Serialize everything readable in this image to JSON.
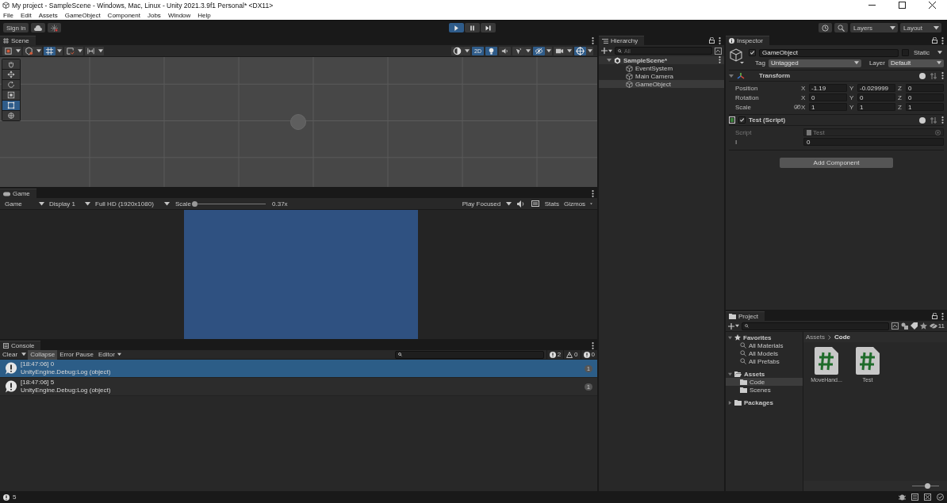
{
  "window": {
    "title": "My project - SampleScene - Windows, Mac, Linux - Unity 2021.3.9f1 Personal* <DX11>"
  },
  "menu": [
    "File",
    "Edit",
    "Assets",
    "GameObject",
    "Component",
    "Jobs",
    "Window",
    "Help"
  ],
  "toolbar": {
    "sign_in": "Sign in",
    "play_controls": [
      {
        "kind": "play",
        "on": true
      },
      {
        "kind": "pause",
        "on": false
      },
      {
        "kind": "step",
        "on": false
      }
    ],
    "layers": "Layers",
    "layout": "Layout"
  },
  "scene": {
    "tab": "Scene",
    "left_toggles": [
      {
        "kind": "draw-mode",
        "on": false
      },
      {
        "kind": "view-options",
        "on": false
      },
      {
        "kind": "grid",
        "on": true
      },
      {
        "kind": "snap",
        "on": false
      },
      {
        "kind": "align",
        "on": false
      }
    ],
    "right_toggles": [
      {
        "kind": "shading",
        "on": false
      },
      {
        "kind": "dimension",
        "label": "2D",
        "on": true
      },
      {
        "kind": "light",
        "on": true
      },
      {
        "kind": "audio",
        "on": false
      },
      {
        "kind": "effects",
        "on": false
      },
      {
        "kind": "visibility",
        "on": true
      },
      {
        "kind": "camera",
        "on": false
      },
      {
        "kind": "gizmos",
        "on": true
      }
    ],
    "tools": [
      {
        "kind": "hand",
        "selected": false
      },
      {
        "kind": "move",
        "selected": false
      },
      {
        "kind": "rotate",
        "selected": false
      },
      {
        "kind": "scale",
        "selected": false
      },
      {
        "kind": "rect",
        "selected": true
      },
      {
        "kind": "transform",
        "selected": false
      }
    ]
  },
  "game": {
    "tab": "Game",
    "view": "Game",
    "display": "Display 1",
    "resolution": "Full HD (1920x1080)",
    "scale_label": "Scale",
    "scale": {
      "level": 0.02
    },
    "scale_reading": "0.37x",
    "play_mode": "Play Focused",
    "stats": "Stats",
    "gizmos": "Gizmos"
  },
  "console": {
    "tab": "Console",
    "clear": "Clear",
    "toggles": [
      {
        "label": "Collapse",
        "on": true
      },
      {
        "label": "Error Pause",
        "on": false
      }
    ],
    "editor": "Editor",
    "counts": [
      {
        "kind": "info",
        "count": "2"
      },
      {
        "kind": "warning",
        "count": "0"
      },
      {
        "kind": "error",
        "count": "0"
      }
    ],
    "entries": [
      {
        "message": "[18:47:06] 0",
        "detail": "UnityEngine.Debug:Log (object)",
        "count": "1",
        "selected": true
      },
      {
        "message": "[18:47:06] 5",
        "detail": "UnityEngine.Debug:Log (object)",
        "count": "1",
        "selected": false
      }
    ]
  },
  "hierarchy": {
    "tab": "Hierarchy",
    "search_placeholder": "All",
    "tree": [
      {
        "label": "SampleScene*",
        "expanded": true,
        "selected": false,
        "children": [
          {
            "label": "EventSystem",
            "selected": false
          },
          {
            "label": "Main Camera",
            "selected": false
          },
          {
            "label": "GameObject",
            "selected": true
          }
        ]
      }
    ]
  },
  "inspector": {
    "tab": "Inspector",
    "object": {
      "active": true,
      "name": "GameObject",
      "static": false,
      "static_label": "Static",
      "tag_label": "Tag",
      "tag": "Untagged",
      "layer_label": "Layer",
      "layer": "Default"
    },
    "components": [
      {
        "kind": "transform",
        "title": "Transform",
        "expanded": true,
        "rows": [
          {
            "label": "Position",
            "linked": false,
            "values": [
              {
                "axis": "X",
                "value": "-1.19"
              },
              {
                "axis": "Y",
                "value": "-0.029999"
              },
              {
                "axis": "Z",
                "value": "0"
              }
            ]
          },
          {
            "label": "Rotation",
            "linked": false,
            "values": [
              {
                "axis": "X",
                "value": "0"
              },
              {
                "axis": "Y",
                "value": "0"
              },
              {
                "axis": "Z",
                "value": "0"
              }
            ]
          },
          {
            "label": "Scale",
            "linked": true,
            "values": [
              {
                "axis": "X",
                "value": "1"
              },
              {
                "axis": "Y",
                "value": "1"
              },
              {
                "axis": "Z",
                "value": "1"
              }
            ]
          }
        ]
      },
      {
        "kind": "script",
        "title": "Test (Script)",
        "enabled": true,
        "fields": [
          {
            "kind": "object",
            "label": "Script",
            "value": "Test"
          },
          {
            "kind": "number",
            "label": "I",
            "value": "0"
          }
        ]
      }
    ],
    "add_component": "Add Component"
  },
  "project": {
    "tab": "Project",
    "hidden_count": "11",
    "tree": [
      {
        "kind": "favorites",
        "label": "Favorites",
        "expanded": true,
        "selected": false,
        "children": [
          {
            "kind": "search",
            "label": "All Materials",
            "selected": false
          },
          {
            "kind": "search",
            "label": "All Models",
            "selected": false
          },
          {
            "kind": "search",
            "label": "All Prefabs",
            "selected": false
          }
        ]
      },
      {
        "kind": "folder",
        "label": "Assets",
        "expanded": true,
        "selected": false,
        "children": [
          {
            "kind": "folder",
            "label": "Code",
            "selected": true
          },
          {
            "kind": "folder",
            "label": "Scenes",
            "selected": false
          }
        ]
      },
      {
        "kind": "folder",
        "label": "Packages",
        "expanded": false,
        "selected": false
      }
    ],
    "breadcrumb": [
      "Assets",
      "Code"
    ],
    "files": [
      {
        "name": "MoveHand..."
      },
      {
        "name": "Test"
      }
    ],
    "icon_size": {
      "level": 0.55
    }
  },
  "status_bar": {
    "message": "5"
  }
}
